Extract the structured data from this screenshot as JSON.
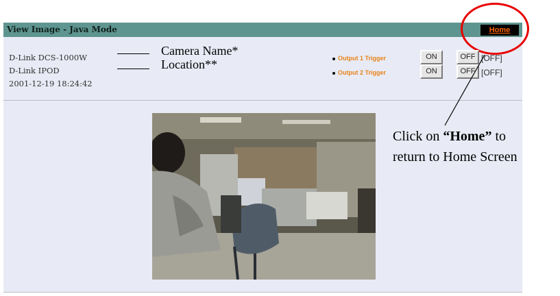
{
  "window": {
    "title": "View Image - Java Mode",
    "home_link": "Home"
  },
  "camera_info": {
    "camera_name": "D-Link DCS-1000W",
    "location": "D-Link IPOD",
    "datetime": "2001-12-19 18:24:42"
  },
  "annotations": {
    "camera_name_label": "Camera Name*",
    "location_label": "Location**",
    "caption_line1_prefix": "Click on ",
    "caption_line1_bold": "“Home”",
    "caption_line1_suffix": " to",
    "caption_line2": "return to Home Screen"
  },
  "outputs": [
    {
      "label": "Output 1 Trigger",
      "on_label": "ON",
      "off_label": "OFF",
      "status": "[OFF]"
    },
    {
      "label": "Output 2 Trigger",
      "on_label": "ON",
      "off_label": "OFF",
      "status": "[OFF]"
    }
  ],
  "colors": {
    "title_bar": "#5f9590",
    "panel_bg": "#e8ebf5",
    "home_text": "#ff6600",
    "trigger_text": "#e8821a",
    "callout": "#e80000"
  },
  "icons": {
    "bullet": "bullet-icon",
    "camera_feed": "camera-image"
  }
}
